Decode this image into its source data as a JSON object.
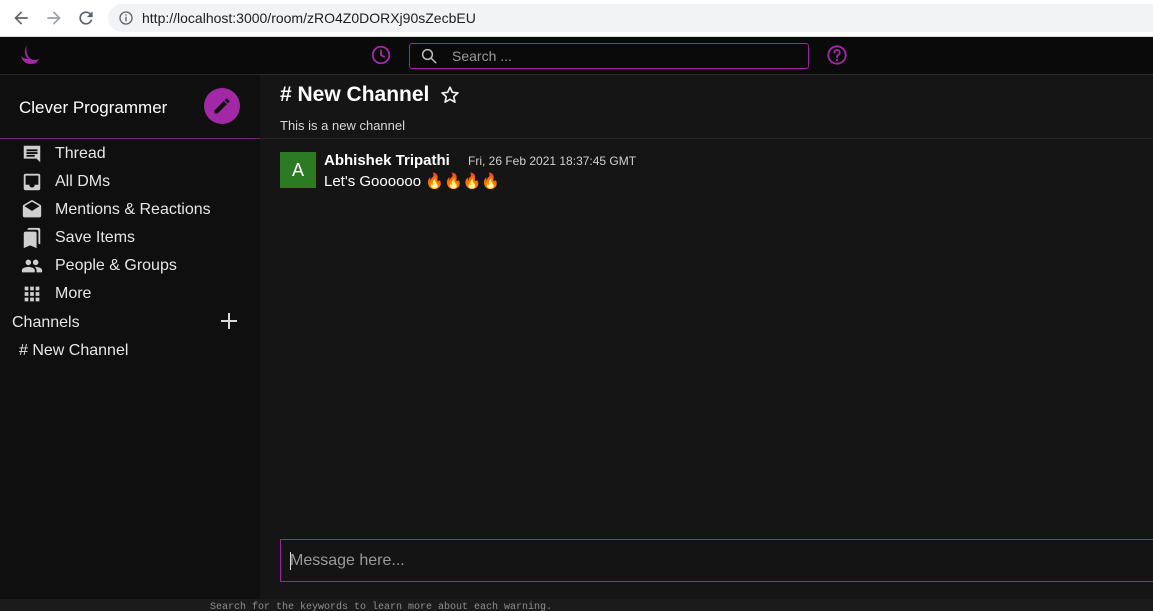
{
  "browser": {
    "url": "http://localhost:3000/room/zRO4Z0DORXj90sZecbEU"
  },
  "header": {
    "search_placeholder": "Search ...",
    "accent_color": "#a41fa6"
  },
  "sidebar": {
    "workspace_name": "Clever Programmer",
    "items": [
      {
        "label": "Thread",
        "icon": "thread-icon"
      },
      {
        "label": "All DMs",
        "icon": "inbox-icon"
      },
      {
        "label": "Mentions & Reactions",
        "icon": "drafts-icon"
      },
      {
        "label": "Save Items",
        "icon": "bookmarks-icon"
      },
      {
        "label": "People & Groups",
        "icon": "people-icon"
      },
      {
        "label": "More",
        "icon": "apps-grid-icon"
      }
    ],
    "channels_label": "Channels",
    "channels": [
      {
        "label": "# New Channel"
      }
    ]
  },
  "channel": {
    "title": "# New Channel",
    "description": "This is a new channel"
  },
  "messages": [
    {
      "avatar_letter": "A",
      "avatar_color": "#2d7a25",
      "user": "Abhishek Tripathi",
      "timestamp": "Fri, 26 Feb 2021 18:37:45 GMT",
      "text": "Let's Goooooo 🔥🔥🔥🔥"
    }
  ],
  "composer": {
    "placeholder": "Message here..."
  },
  "console": {
    "text": "Search for the keywords to learn more about each warning."
  }
}
